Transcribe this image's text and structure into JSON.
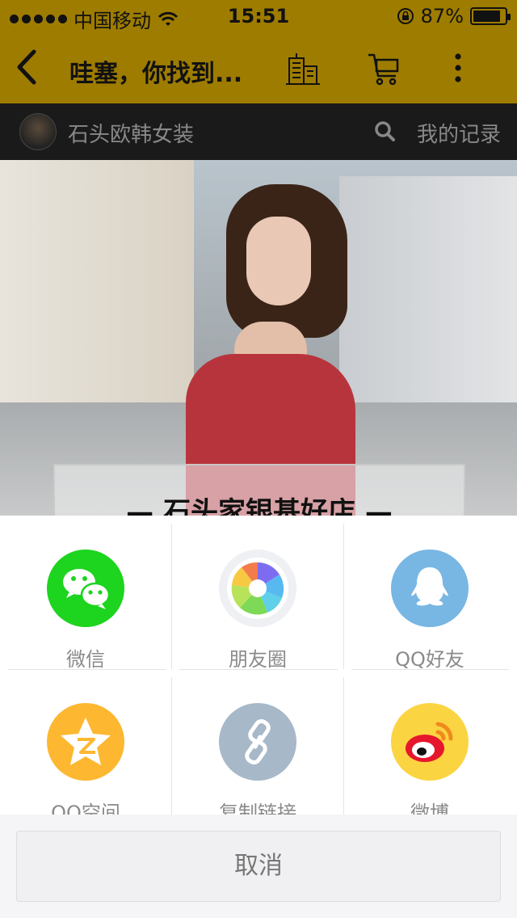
{
  "status_bar": {
    "carrier": "中国移动",
    "time": "15:51",
    "battery_percent": "87%",
    "battery_level": 0.87
  },
  "nav": {
    "title": "哇塞，你找到...",
    "icons": [
      "back-arrow-icon",
      "shop-building-icon",
      "cart-icon",
      "more-dots-icon"
    ]
  },
  "search": {
    "shop_name": "石头欧韩女装",
    "records_label": "我的记录"
  },
  "banner": {
    "title": "石头家银基好店"
  },
  "share": {
    "items": [
      {
        "label": "微信",
        "icon": "wechat-icon",
        "color": "#1dd41f"
      },
      {
        "label": "朋友圈",
        "icon": "moments-icon",
        "color": "#eef0f3"
      },
      {
        "label": "QQ好友",
        "icon": "qq-icon",
        "color": "#78b6e3"
      },
      {
        "label": "QQ空间",
        "icon": "qzone-icon",
        "color": "#fdb731"
      },
      {
        "label": "复制链接",
        "icon": "link-icon",
        "color": "#a7b8c8"
      },
      {
        "label": "微博",
        "icon": "weibo-icon",
        "color": "#fbd442"
      }
    ],
    "cancel_label": "取消"
  },
  "colors": {
    "header": "#9e7c00",
    "search_bar": "#1a1a1a"
  }
}
